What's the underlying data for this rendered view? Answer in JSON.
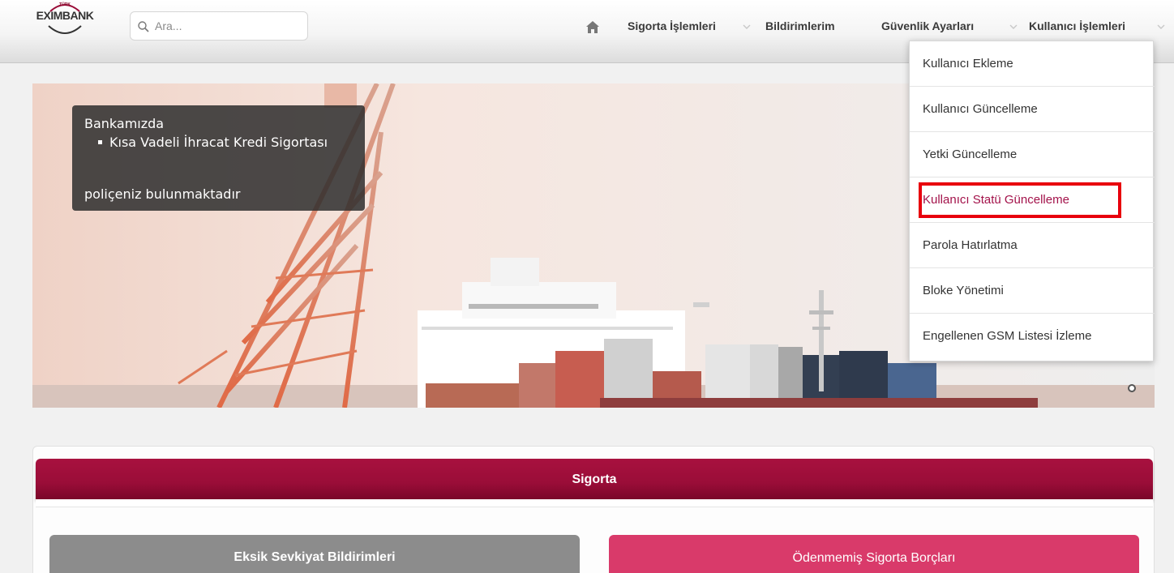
{
  "header": {
    "logo_text": "EXIMBANK",
    "logo_small": "TÜRK",
    "search": {
      "placeholder": "Ara..."
    },
    "nav": [
      {
        "label": "Sigorta İşlemleri"
      },
      {
        "label": "Bildirimlerim"
      },
      {
        "label": "Güvenlik Ayarları"
      },
      {
        "label": "Kullanıcı İşlemleri"
      }
    ]
  },
  "banner": {
    "info_line1": "Bankamızda",
    "info_bullet": "Kısa Vadeli İhracat Kredi Sigortası",
    "info_line3": "poliçeniz bulunmaktadır"
  },
  "dropdown": {
    "items": [
      {
        "label": "Kullanıcı Ekleme"
      },
      {
        "label": "Kullanıcı Güncelleme"
      },
      {
        "label": "Yetki Güncelleme"
      },
      {
        "label": "Kullanıcı Statü Güncelleme",
        "active": true
      },
      {
        "label": "Parola Hatırlatma"
      },
      {
        "label": "Bloke Yönetimi"
      },
      {
        "label": "Engellenen GSM Listesi İzleme"
      }
    ]
  },
  "sigorta": {
    "title": "Sigorta",
    "card_left": "Eksik Sevkiyat Bildirimleri",
    "card_right": "Ödenmemiş Sigorta Borçları"
  },
  "colors": {
    "brand": "#9a0d38",
    "highlight_box": "#e8000d",
    "active_menu": "#a3124a",
    "card_grey": "#8c8c8c",
    "card_pink": "#d93a6a"
  }
}
